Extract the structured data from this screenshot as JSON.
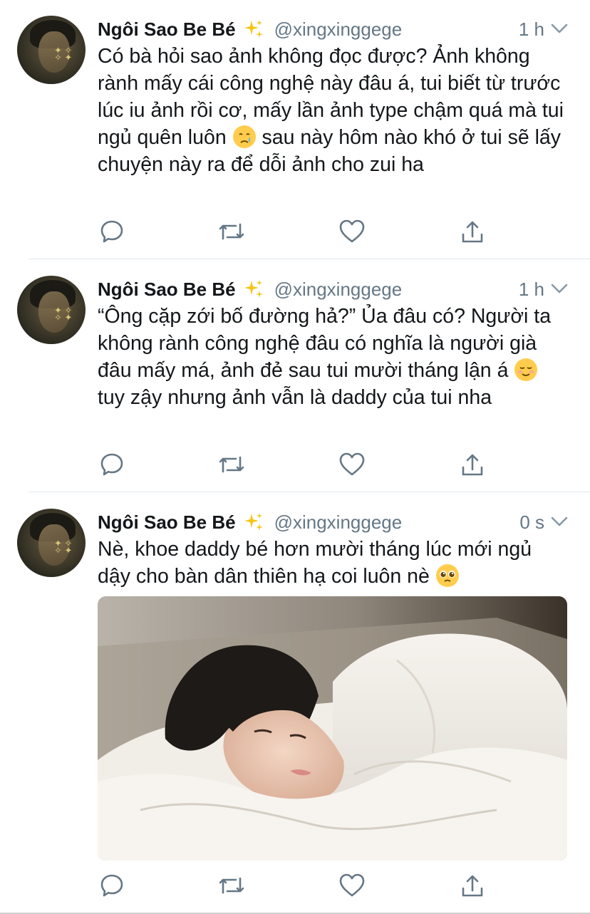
{
  "tweets": [
    {
      "display_name": "Ngôi Sao Be Bé",
      "handle": "@xingxinggege",
      "time": "1 h",
      "text_parts": [
        "Có bà hỏi sao ảnh không đọc được? Ảnh không rành mấy cái công nghệ này đâu á, tui biết từ trước lúc iu ảnh rồi cơ, mấy lần ảnh type chậm quá mà tui ngủ quên luôn ",
        " sau này hôm nào khó ở tui sẽ lấy chuyện này ra để dỗi ảnh cho zui ha"
      ],
      "emoji": "crying-face-emoji"
    },
    {
      "display_name": "Ngôi Sao Be Bé",
      "handle": "@xingxinggege",
      "time": "1 h",
      "text_parts": [
        "“Ông cặp zới bố đường hả?” Ủa đâu có? Người ta không rành công nghệ đâu có nghĩa là người già đâu mấy má, ảnh đẻ sau tui mười tháng lận á ",
        " tuy zậy nhưng ảnh vẫn là daddy của tui nha"
      ],
      "emoji": "smiling-face-emoji"
    },
    {
      "display_name": "Ngôi Sao Be Bé",
      "handle": "@xingxinggege",
      "time": "0 s",
      "text_parts": [
        "Nè, khoe daddy bé hơn mười tháng lúc mới ngủ dậy cho bàn dân thiên hạ coi luôn nè ",
        ""
      ],
      "emoji": "pleading-face-emoji",
      "photo": "person-sleeping-under-white-blanket"
    }
  ],
  "colors": {
    "text": "#14171a",
    "secondary": "#657786",
    "divider": "#e1e8ed"
  },
  "icons": [
    "reply-icon",
    "retweet-icon",
    "like-icon",
    "share-icon",
    "chevron-down-icon",
    "sparkles-icon"
  ]
}
